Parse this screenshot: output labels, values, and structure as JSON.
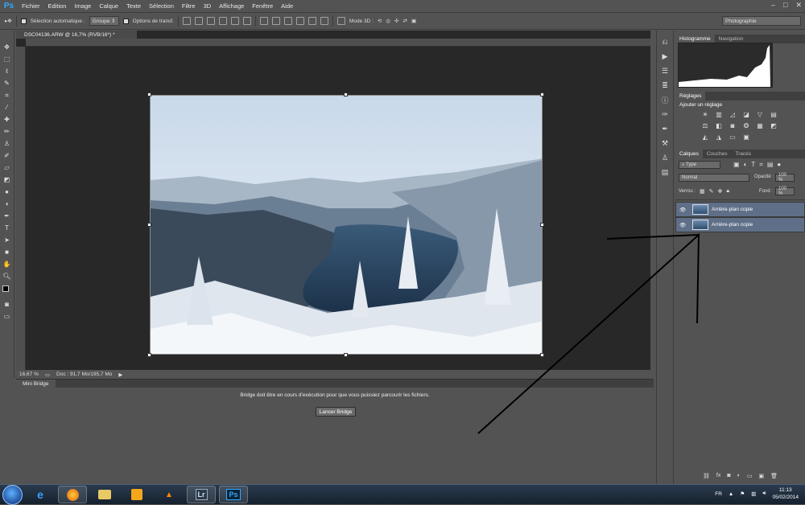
{
  "app": {
    "logo": "Ps"
  },
  "menu": [
    "Fichier",
    "Edition",
    "Image",
    "Calque",
    "Texte",
    "Sélection",
    "Filtre",
    "3D",
    "Affichage",
    "Fenêtre",
    "Aide"
  ],
  "options": {
    "auto_select_label": "Sélection automatique :",
    "auto_select_value": "Groupe",
    "transform_label": "Options de transf.",
    "mode3d_label": "Mode 3D :",
    "workspace": "Photographie"
  },
  "document": {
    "tab_title": "DSC04136.ARW @ 16,7% (RVB/16*) *",
    "zoom": "16,67 %",
    "doc_info": "Doc : 91,7 Mo/195,7 Mo"
  },
  "bridge": {
    "title": "Mini Bridge",
    "message": "Bridge doit être en cours d'exécution pour que vous puissiez parcourir les fichiers.",
    "button": "Lancer Bridge"
  },
  "panels": {
    "histo_tabs": [
      "Histogramme",
      "Navigation"
    ],
    "adjust_tab": "Réglages",
    "adjust_title": "Ajouter un réglage",
    "layer_tabs": [
      "Calques",
      "Couches",
      "Tracés"
    ],
    "filter_type": "Type",
    "blend_mode": "Normal",
    "opacity_label": "Opacité :",
    "opacity_value": "100 %",
    "lock_label": "Verrou :",
    "fill_label": "Fond :",
    "fill_value": "100 %",
    "layers": [
      "Arrière-plan copie",
      "Arrière-plan copie"
    ]
  },
  "taskbar": {
    "apps": [
      "ie",
      "firefox",
      "explorer",
      "media",
      "vlc",
      "Lr",
      "Ps"
    ],
    "lang": "FR",
    "time": "11:13",
    "date": "05/02/2014"
  }
}
